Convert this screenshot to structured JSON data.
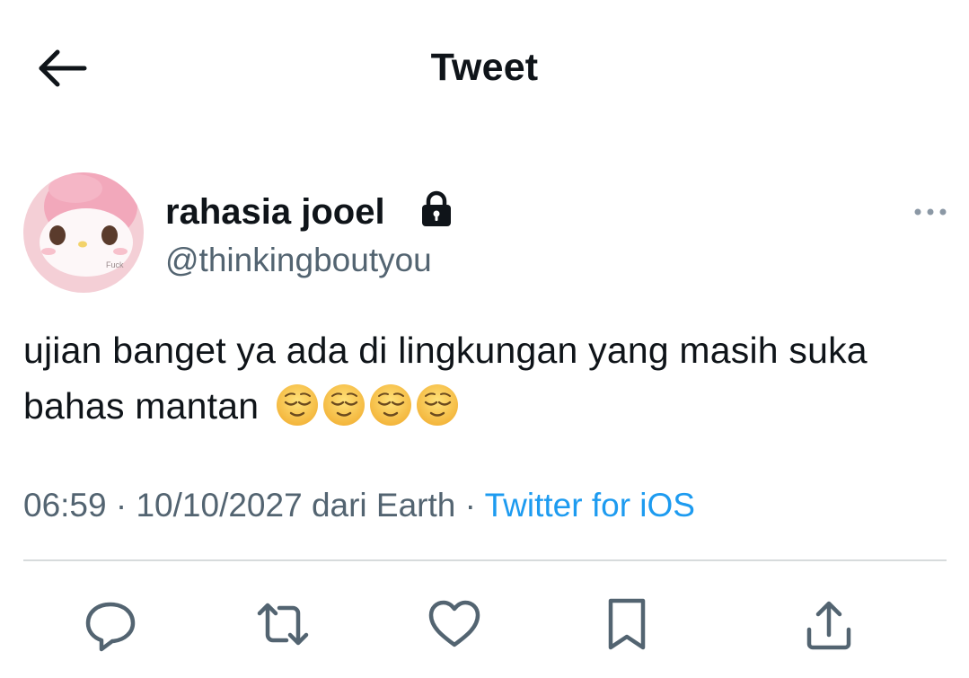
{
  "header": {
    "title": "Tweet",
    "back_icon": "arrow-left-icon"
  },
  "author": {
    "display_name": "rahasia jooel",
    "handle": "@thinkingboutyou",
    "protected_icon": "lock-icon",
    "avatar_text": "Fuck"
  },
  "tweet": {
    "text": "ujian banget ya ada di lingkungan yang masih suka bahas mantan",
    "emojis": [
      "relieved-face-emoji",
      "relieved-face-emoji",
      "relieved-face-emoji",
      "relieved-face-emoji"
    ]
  },
  "meta": {
    "time": "06:59",
    "sep1": " · ",
    "date": "10/10/2027",
    "location": " dari Earth",
    "sep2": " · ",
    "source": "Twitter for iOS"
  },
  "actions": {
    "reply": "reply-icon",
    "retweet": "retweet-icon",
    "like": "heart-icon",
    "bookmark": "bookmark-icon",
    "share": "share-icon"
  },
  "colors": {
    "text": "#0f1419",
    "secondary": "#536471",
    "link": "#1d9bf0",
    "divider": "#d7dbdc"
  }
}
